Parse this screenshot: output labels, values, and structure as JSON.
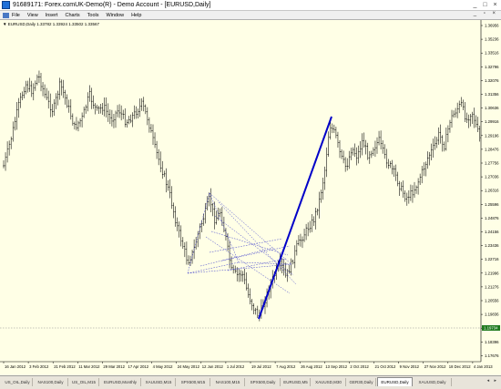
{
  "window": {
    "title": "91689171: Forex.comUK-Demo(R) - Demo Account - [EURUSD,Daily]",
    "controls": [
      "_",
      "□",
      "×"
    ]
  },
  "menu": {
    "items": [
      "File",
      "View",
      "Insert",
      "Charts",
      "Tools",
      "Window",
      "Help"
    ],
    "mdi_controls": "_ ▫ ×"
  },
  "chart": {
    "info": "▼ EURUSD,Daily  1.33782 1.33924 1.33502 1.33567",
    "current_price": "1.19734",
    "colors": {
      "background": "#ffffe6",
      "bars": "#000000",
      "trendline": "#0000c8",
      "fib": "#3a3acc",
      "grid": "#8c8c8c"
    },
    "price_ticks": [
      "1.36956",
      "1.35236",
      "1.33516",
      "1.32796",
      "1.32076",
      "1.31356",
      "1.30636",
      "1.29916",
      "1.29196",
      "1.28476",
      "1.27756",
      "1.27036",
      "1.26316",
      "1.25596",
      "1.24876",
      "1.24156",
      "1.23436",
      "1.22716",
      "1.21996",
      "1.21276",
      "1.20556",
      "1.19836",
      "1.19116",
      "1.18396",
      "1.17676"
    ],
    "date_ticks": [
      "16 Jan 2012",
      "3 Feb 2012",
      "21 Feb 2012",
      "11 Mar 2012",
      "29 Mar 2012",
      "17 Apr 2012",
      "4 May 2012",
      "24 May 2012",
      "12 Jun 2012",
      "1 Jul 2012",
      "19 Jul 2012",
      "7 Aug 2012",
      "26 Aug 2012",
      "13 Sep 2012",
      "2 Oct 2012",
      "21 Oct 2012",
      "9 Nov 2012",
      "27 Nov 2012",
      "18 Dec 2012",
      "4 Jan 2013"
    ]
  },
  "tabs": {
    "items": [
      "US_OIL,Daily",
      "NAS100,Daily",
      "US_OIL,M15",
      "EURUSD,Monthly",
      "XAUUSD,M15",
      "SPX500,M15",
      "NAS100,M15",
      "SPX500,Daily",
      "EURUSD,M5",
      "XAUUSD,M30",
      "GER30,Daily",
      "EURUSD,Daily",
      "XAUUSD,Daily"
    ],
    "active": "EURUSD,Daily",
    "arrows": "◂ ▸"
  }
}
